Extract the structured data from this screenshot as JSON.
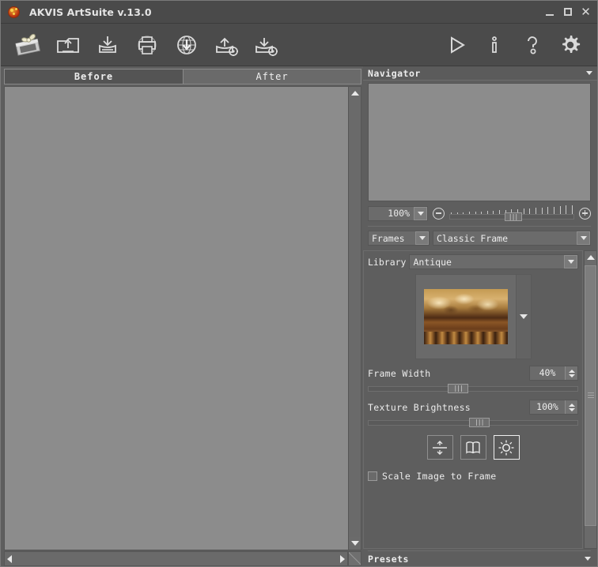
{
  "window": {
    "title": "AKVIS ArtSuite v.13.0",
    "app_icon": "akvis-ball-icon",
    "minimize_label": "–",
    "maximize_label": "□",
    "close_label": "✕"
  },
  "toolbar": {
    "left_tools": [
      {
        "name": "new-frame-gift-icon",
        "label": "New"
      },
      {
        "name": "open-image-icon",
        "label": "Open Image"
      },
      {
        "name": "save-image-icon",
        "label": "Save Image"
      },
      {
        "name": "print-image-icon",
        "label": "Print Image"
      },
      {
        "name": "publish-web-icon",
        "label": "Publish to Web"
      },
      {
        "name": "load-preset-icon",
        "label": "Load Settings"
      },
      {
        "name": "save-preset-icon",
        "label": "Save Settings"
      }
    ],
    "right_tools": [
      {
        "name": "run-play-icon",
        "label": "Run"
      },
      {
        "name": "info-icon",
        "label": "Info"
      },
      {
        "name": "help-icon",
        "label": "Help"
      },
      {
        "name": "preferences-gear-icon",
        "label": "Preferences"
      }
    ]
  },
  "tabs": [
    {
      "label": "Before",
      "selected": true
    },
    {
      "label": "After",
      "selected": false
    }
  ],
  "navigator": {
    "title": "Navigator",
    "collapse_icon": "chevron-down-icon",
    "zoom_value": "100%",
    "zoom_out_icon": "zoom-out-icon",
    "zoom_in_icon": "zoom-in-icon"
  },
  "effect": {
    "category": "Frames",
    "style": "Classic Frame"
  },
  "settings": {
    "library_label": "Library",
    "library_value": "Antique",
    "thumbnail_name": "antique-frame-thumbnail",
    "frame_width": {
      "label": "Frame Width",
      "value": "40%"
    },
    "texture_brightness": {
      "label": "Texture Brightness",
      "value": "100%"
    },
    "icon_buttons": [
      {
        "name": "flip-vertical-icon",
        "active": false
      },
      {
        "name": "mirror-horizontal-icon",
        "active": false
      },
      {
        "name": "brightness-sun-icon",
        "active": true
      }
    ],
    "scale_checkbox": {
      "label": "Scale Image to Frame",
      "checked": false
    }
  },
  "presets": {
    "title": "Presets",
    "collapse_icon": "chevron-down-icon"
  },
  "colors": {
    "window_bg": "#5e5e5e",
    "titlebar_bg": "#4a4a4a",
    "toolbar_bg": "#4b4b4b",
    "canvas_bg": "#8c8c8c",
    "text": "#ececec"
  }
}
